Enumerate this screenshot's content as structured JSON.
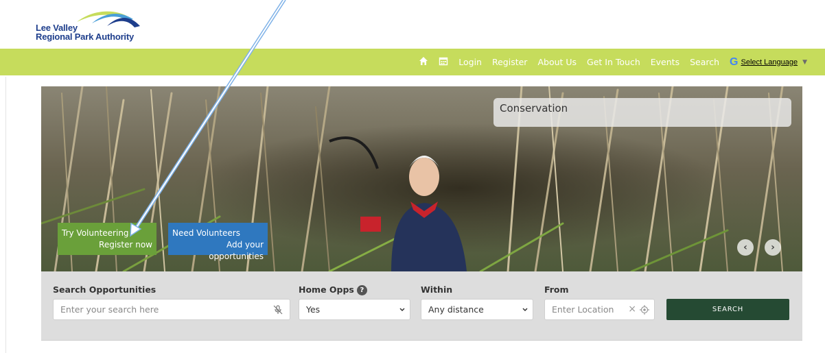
{
  "brand": {
    "line1": "Lee Valley",
    "line2": "Regional Park Authority"
  },
  "nav": {
    "icons": [
      "home-icon",
      "calendar-icon"
    ],
    "items": [
      "Login",
      "Register",
      "About Us",
      "Get In Touch",
      "Events",
      "Search"
    ],
    "translate_logo": "G",
    "language_label": "Select Language",
    "language_arrow": "▼"
  },
  "hero": {
    "caption": "Conservation",
    "volunteer_cta": {
      "line1": "Try Volunteering",
      "line2": "Register now"
    },
    "organisation_cta": {
      "line1": "Need Volunteers",
      "line2": "Add your opportunities"
    },
    "carousel": {
      "prev": "‹",
      "next": "›"
    }
  },
  "search": {
    "opportunities": {
      "label": "Search Opportunities",
      "placeholder": "Enter your search here"
    },
    "home_opps": {
      "label": "Home Opps",
      "help": "?",
      "value": "Yes"
    },
    "within": {
      "label": "Within",
      "value": "Any distance"
    },
    "from": {
      "label": "From",
      "placeholder": "Enter Location",
      "clear": "×"
    },
    "button": "SEARCH"
  },
  "colors": {
    "nav_bar": "#c6dc5c",
    "brand_blue": "#1e3e8c",
    "cta_green": "#6aa03a",
    "cta_blue": "#2f78bf",
    "search_button": "#254a33"
  }
}
